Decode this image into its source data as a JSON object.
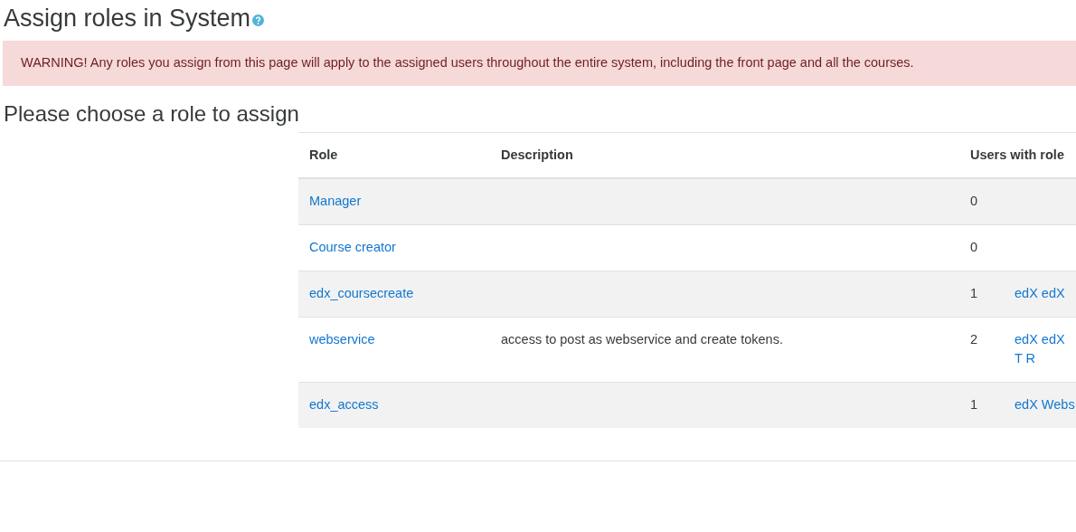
{
  "page_title": "Assign roles in System",
  "warning": "WARNING! Any roles you assign from this page will apply to the assigned users throughout the entire system, including the front page and all the courses.",
  "section_title": "Please choose a role to assign",
  "table": {
    "columns": [
      "Role",
      "Description",
      "Users with role"
    ],
    "rows": [
      {
        "role": "Manager",
        "description": "",
        "count": "0",
        "users": []
      },
      {
        "role": "Course creator",
        "description": "",
        "count": "0",
        "users": []
      },
      {
        "role": "edx_coursecreate",
        "description": "",
        "count": "1",
        "users": [
          "edX edX"
        ]
      },
      {
        "role": "webservice",
        "description": "access to post as webservice and create tokens.",
        "count": "2",
        "users": [
          "edX edX",
          "T R"
        ]
      },
      {
        "role": "edx_access",
        "description": "",
        "count": "1",
        "users": [
          "edX Webs"
        ]
      }
    ]
  }
}
